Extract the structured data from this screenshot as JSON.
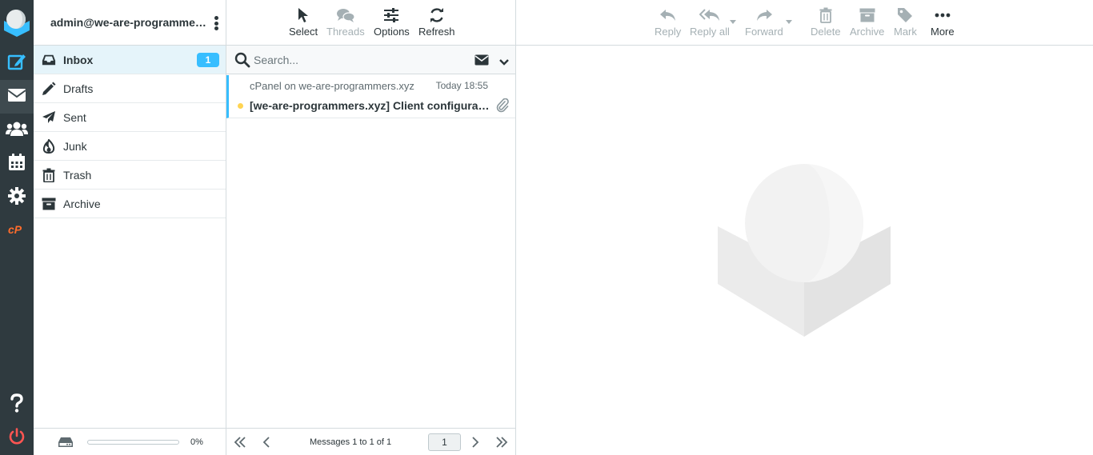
{
  "account": {
    "user": "admin@we-are-programmers.xyz"
  },
  "folders": [
    {
      "label": "Inbox",
      "icon": "inbox-icon",
      "unread": "1",
      "active": true
    },
    {
      "label": "Drafts",
      "icon": "pencil-icon"
    },
    {
      "label": "Sent",
      "icon": "paper-plane-icon"
    },
    {
      "label": "Junk",
      "icon": "fire-icon"
    },
    {
      "label": "Trash",
      "icon": "trash-icon"
    },
    {
      "label": "Archive",
      "icon": "archive-icon"
    }
  ],
  "quota": {
    "percent": "0%",
    "fraction": 0
  },
  "list_toolbar": {
    "select": "Select",
    "threads": "Threads",
    "options": "Options",
    "refresh": "Refresh"
  },
  "search": {
    "placeholder": "Search..."
  },
  "messages": [
    {
      "from": "cPanel on we-are-programmers.xyz",
      "date": "Today 18:55",
      "subject": "[we-are-programmers.xyz] Client configuration settings for “admin@we-are-programmers.xyz”",
      "unread": true,
      "has_attachment": true
    }
  ],
  "list_footer": {
    "count": "Messages 1 to 1 of 1",
    "page": "1"
  },
  "message_toolbar": {
    "reply": "Reply",
    "reply_all": "Reply all",
    "forward": "Forward",
    "delete": "Delete",
    "archive": "Archive",
    "mark": "Mark",
    "more": "More"
  },
  "colors": {
    "rail": "#2f3a3f",
    "accent": "#37beff",
    "compose": "#37beff",
    "cpanel": "#ff6c2c",
    "logout": "#ff5552",
    "unread_dot": "#ffd452"
  }
}
